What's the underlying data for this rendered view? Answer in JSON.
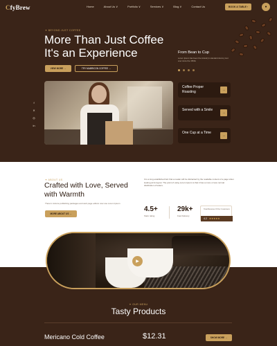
{
  "header": {
    "logo_prefix": "C",
    "logo_rest": "fyBrew",
    "nav": [
      "Home",
      "About Us ∨",
      "Portfolio ∨",
      "Services ∨",
      "Blog ∨",
      "Contact Us"
    ],
    "book_label": "BOOK A TABLE ›"
  },
  "hero": {
    "eyebrow": "✦ BEYOND JUST COFFEE",
    "title": "More Than Just Coffee It's an Experience",
    "btn_about": "VIEW MORE →",
    "btn_menu": "TRY MABRICON COFFEE →",
    "from_title": "From Bean to Cup",
    "from_desc": "Lorem Ipsum has been the industry's standard dummy text ever since the 1500s",
    "features": [
      "Coffee Proper Roasting",
      "Served with a Smile",
      "One Cup at a Time"
    ],
    "socials": [
      "f",
      "✕",
      "◎",
      "in"
    ]
  },
  "about": {
    "eyebrow": "✦ ABOUT US",
    "title": "Crafted with Love, Served with Warmth",
    "desc": "There's mixture publishing packages and web page editors now use Lorem Ipsum",
    "btn": "MORE ABOUT US →",
    "paragraph": "It is a long established fact that a reader will be distracted by the readable content of a page when looking at its layout. The point of using Lorem Ipsum is that it has a more or less normal distribution of letters.",
    "stats": [
      {
        "num": "4.5+",
        "label": "Stars rating"
      },
      {
        "num": "29k+",
        "label": "Fast Delivery"
      }
    ],
    "review": {
      "label": "Total Reviews Of Our Customers",
      "score": "4.2",
      "stars": "★★★★★"
    }
  },
  "media": {
    "play_icon": "▶"
  },
  "products": {
    "eyebrow": "✦ OUR MENU",
    "title": "Tasty Products",
    "item_name": "Mericano Cold Coffee",
    "item_price": "$12.31",
    "item_btn": "SHOW MORE →"
  },
  "colors": {
    "accent": "#c9a05c",
    "dark": "#3a2418",
    "card": "#2c1a10"
  }
}
